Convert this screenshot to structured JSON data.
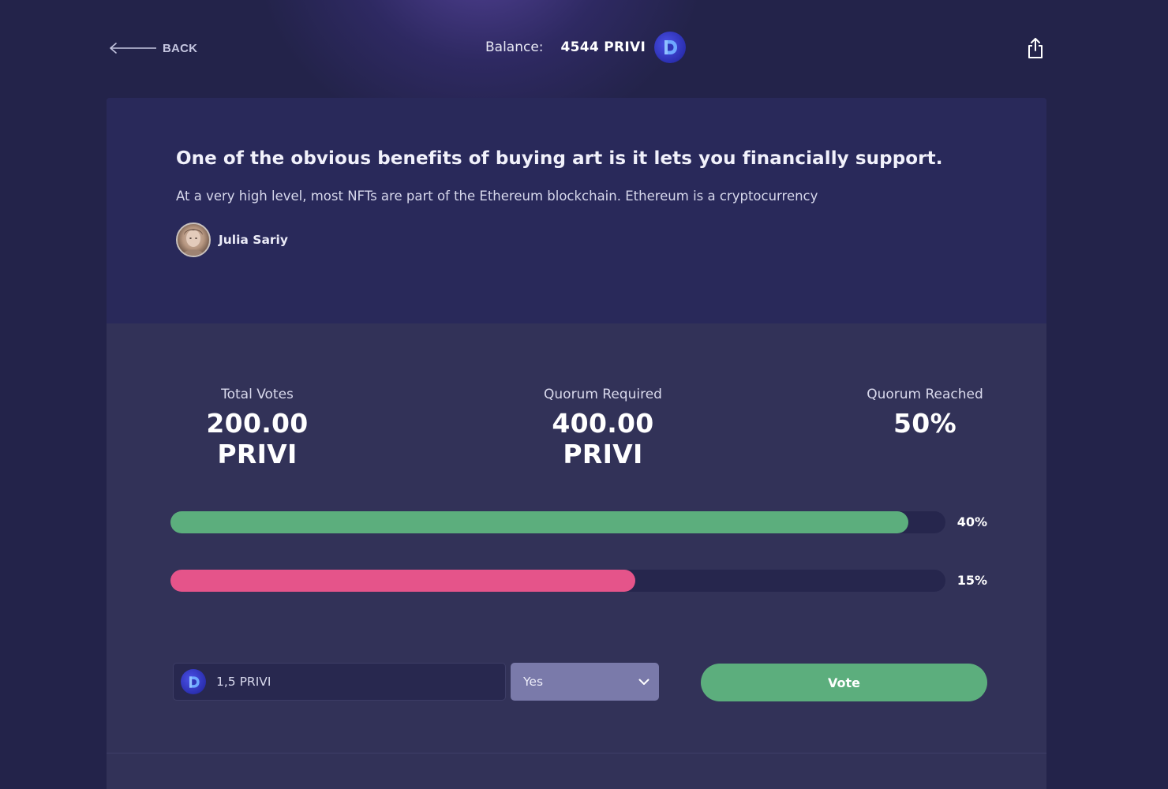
{
  "header": {
    "back_label": "BACK",
    "balance_label": "Balance:",
    "balance_value": "4544 PRIVI"
  },
  "proposal": {
    "title": "One of the obvious benefits of buying art is it lets you financially support.",
    "description": "At a very high level, most NFTs are part of the Ethereum blockchain. Ethereum is a cryptocurrency",
    "author_name": "Julia Sariy"
  },
  "stats": [
    {
      "label": "Total Votes",
      "value": "200.00 PRIVI"
    },
    {
      "label": "Quorum Required",
      "value": "400.00 PRIVI"
    },
    {
      "label": "Quorum Reached",
      "value": "50%"
    }
  ],
  "bars": [
    {
      "label": "40%",
      "fill_fraction": 0.952,
      "color": "#5cae7d"
    },
    {
      "label": "15%",
      "fill_fraction": 0.6,
      "color": "#e5548a"
    }
  ],
  "vote_form": {
    "amount_value": "1,5 PRIVI",
    "option_selected": "Yes",
    "vote_label": "Vote"
  },
  "icons": {
    "back": "arrow-left-icon",
    "token": "privi-coin-icon",
    "share": "share-icon",
    "dropdown": "chevron-down-icon"
  },
  "colors": {
    "background": "#23234a",
    "card_top": "#29295a",
    "card_body": "#323258",
    "accent_green": "#5cae7d",
    "accent_pink": "#e5548a",
    "select_bg": "#7a7aaa"
  }
}
